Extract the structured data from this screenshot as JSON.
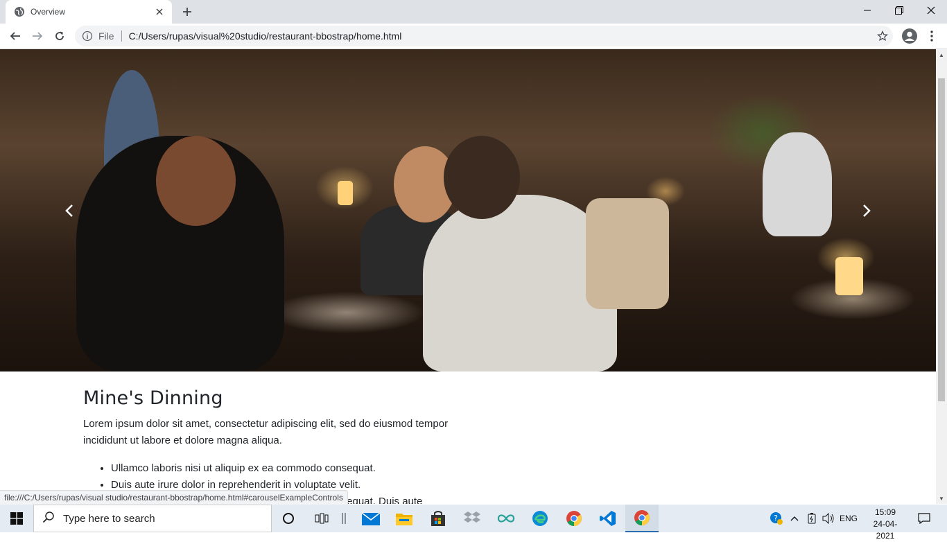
{
  "browser": {
    "tab_title": "Overview",
    "omnibox_scheme": "File",
    "url": "C:/Users/rupas/visual%20studio/restaurant-bbostrap/home.html",
    "status_url": "file:///C:/Users/rupas/visual studio/restaurant-bbostrap/home.html#carouselExampleControls"
  },
  "page": {
    "heading": "Mine's Dinning",
    "paragraph": "Lorem ipsum dolor sit amet, consectetur adipiscing elit, sed do eiusmod tempor incididunt ut labore et dolore magna aliqua.",
    "bullets": [
      "Ullamco laboris nisi ut aliquip ex ea commodo consequat.",
      "Duis aute irure dolor in reprehenderit in voluptate velit.",
      "Ullamco laboris nisi ut aliquip ex ea commodo consequat. Duis aute"
    ]
  },
  "taskbar": {
    "search_placeholder": "Type here to search",
    "language": "ENG",
    "time": "15:09",
    "date": "24-04-2021"
  },
  "colors": {
    "tab_strip": "#dee1e6",
    "taskbar": "#e4ebf3",
    "accent_blue": "#0078d4"
  }
}
